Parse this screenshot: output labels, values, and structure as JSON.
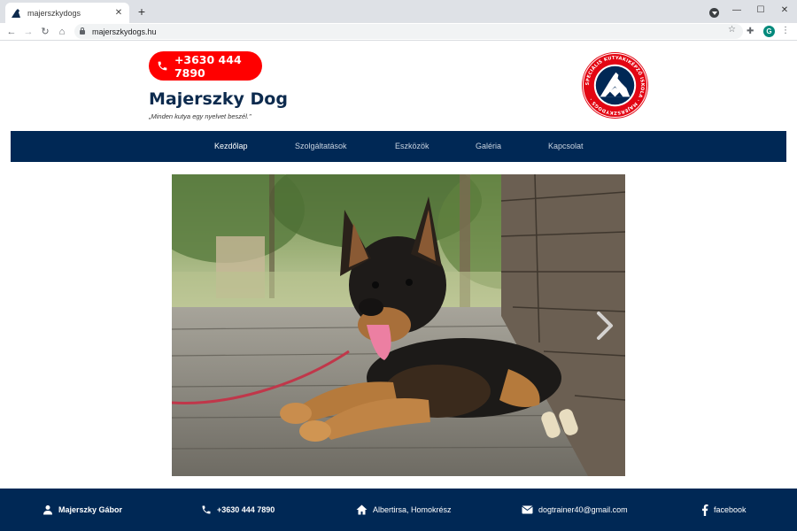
{
  "browser": {
    "tab_title": "majerszkydogs",
    "tab_close": "✕",
    "new_tab": "+",
    "url": "majerszkydogs.hu",
    "profile_initial": "G"
  },
  "header": {
    "phone": "+3630 444 7890",
    "title": "Majerszky Dog",
    "tagline": "„Minden kutya egy nyelvet beszél.”",
    "logo_text": "SPECIÁLIS KUTYAKIKÉPZŐ ISKOLA · MAJERSZKYDOGS ·"
  },
  "nav": {
    "items": [
      {
        "label": "Kezdőlap",
        "active": true
      },
      {
        "label": "Szolgáltatások",
        "active": false
      },
      {
        "label": "Eszközök",
        "active": false
      },
      {
        "label": "Galéria",
        "active": false
      },
      {
        "label": "Kapcsolat",
        "active": false
      }
    ]
  },
  "hero": {
    "next_icon": "chevron-right-icon"
  },
  "footer": {
    "name": "Majerszky Gábor",
    "phone": "+3630 444 7890",
    "address": "Albertirsa, Homokrész",
    "email": "dogtrainer40@gmail.com",
    "social": "facebook"
  },
  "colors": {
    "navy": "#002855",
    "red": "#ff0000",
    "title": "#0d2b4e"
  }
}
